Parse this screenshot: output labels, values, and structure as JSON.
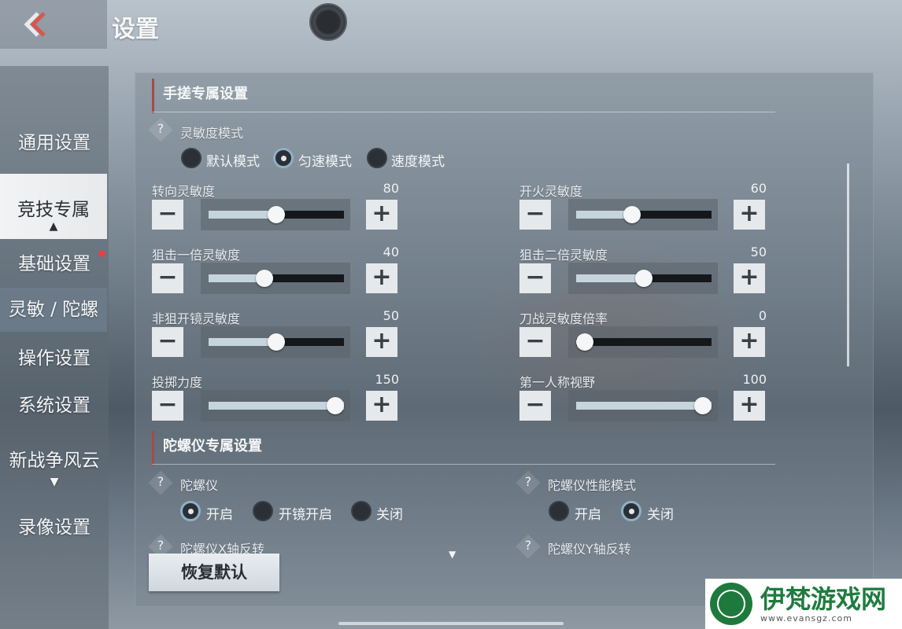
{
  "header": {
    "title": "设置"
  },
  "sidebar": {
    "items": [
      {
        "label": "通用设置"
      },
      {
        "label": "竞技专属",
        "arrow": "▲"
      },
      {
        "label": "基础设置"
      },
      {
        "label": "灵敏 / 陀螺"
      },
      {
        "label": "操作设置"
      },
      {
        "label": "系统设置"
      },
      {
        "label": "新战争风云",
        "arrow": "▼"
      },
      {
        "label": "录像设置"
      }
    ]
  },
  "handheld": {
    "title": "手搓专属设置",
    "mode": {
      "label": "灵敏度模式",
      "help": "?",
      "options": [
        "默认模式",
        "匀速模式",
        "速度模式"
      ],
      "selected": "匀速模式"
    },
    "sliders": [
      {
        "label": "转向灵敏度",
        "value": "80",
        "fraction": 0.5
      },
      {
        "label": "开火灵敏度",
        "value": "60",
        "fraction": 0.4
      },
      {
        "label": "狙击一倍灵敏度",
        "value": "40",
        "fraction": 0.4
      },
      {
        "label": "狙击二倍灵敏度",
        "value": "50",
        "fraction": 0.5
      },
      {
        "label": "非狙开镜灵敏度",
        "value": "50",
        "fraction": 0.5
      },
      {
        "label": "刀战灵敏度倍率",
        "value": "0",
        "fraction": 0.0
      },
      {
        "label": "投掷力度",
        "value": "150",
        "fraction": 1.0
      },
      {
        "label": "第一人称视野",
        "value": "100",
        "fraction": 1.0
      }
    ],
    "minus": "−",
    "plus": "+"
  },
  "gyro": {
    "title": "陀螺仪专属设置",
    "gyroscope": {
      "label": "陀螺仪",
      "help": "?",
      "options": [
        "开启",
        "开镜开启",
        "关闭"
      ],
      "selected": "开启"
    },
    "performance": {
      "label": "陀螺仪性能模式",
      "help": "?",
      "options": [
        "开启",
        "关闭"
      ],
      "selected": "关闭"
    },
    "x_invert": {
      "label": "陀螺仪X轴反转",
      "help": "?"
    },
    "y_invert": {
      "label": "陀螺仪Y轴反转",
      "help": "?"
    }
  },
  "footer": {
    "reset": "恢复默认"
  },
  "watermark": {
    "name": "伊梵游戏网",
    "url": "www.evansgz.com"
  },
  "colors": {
    "accent": "#8fb0c7",
    "section_bar": "#a24b4b",
    "watermark": "#1e7a3c"
  }
}
